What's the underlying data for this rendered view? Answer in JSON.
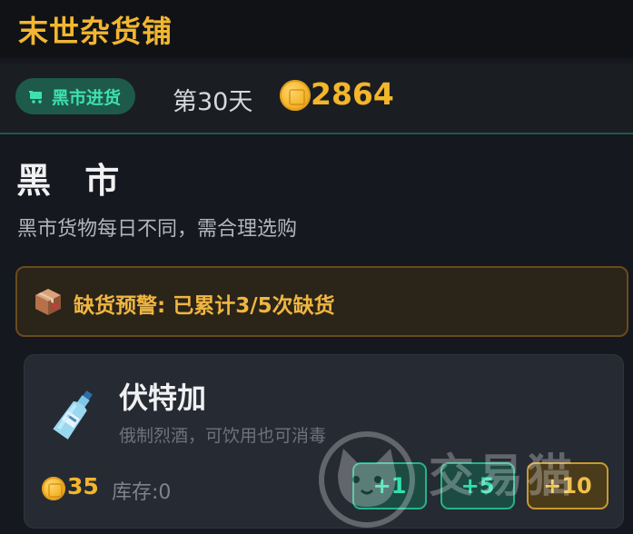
{
  "header": {
    "game_title": "末世杂货铺"
  },
  "status": {
    "mode_label": "黑市进货",
    "day_label": "第30天",
    "gold": "2864"
  },
  "market": {
    "title": "黑 市",
    "description": "黑市货物每日不同，需合理选购"
  },
  "warning": {
    "text": "缺货预警: 已累计3/5次缺货"
  },
  "item": {
    "name": "伏特加",
    "description": "俄制烈酒，可饮用也可消毒",
    "price": "35",
    "stock": "库存:0",
    "buttons": {
      "add1": "+1",
      "add5": "+5",
      "add10": "+10"
    }
  },
  "watermark": {
    "text": "交易猫"
  },
  "colors": {
    "accent_gold": "#f2b630",
    "accent_green": "#3fe0b0",
    "background": "#15181e"
  }
}
